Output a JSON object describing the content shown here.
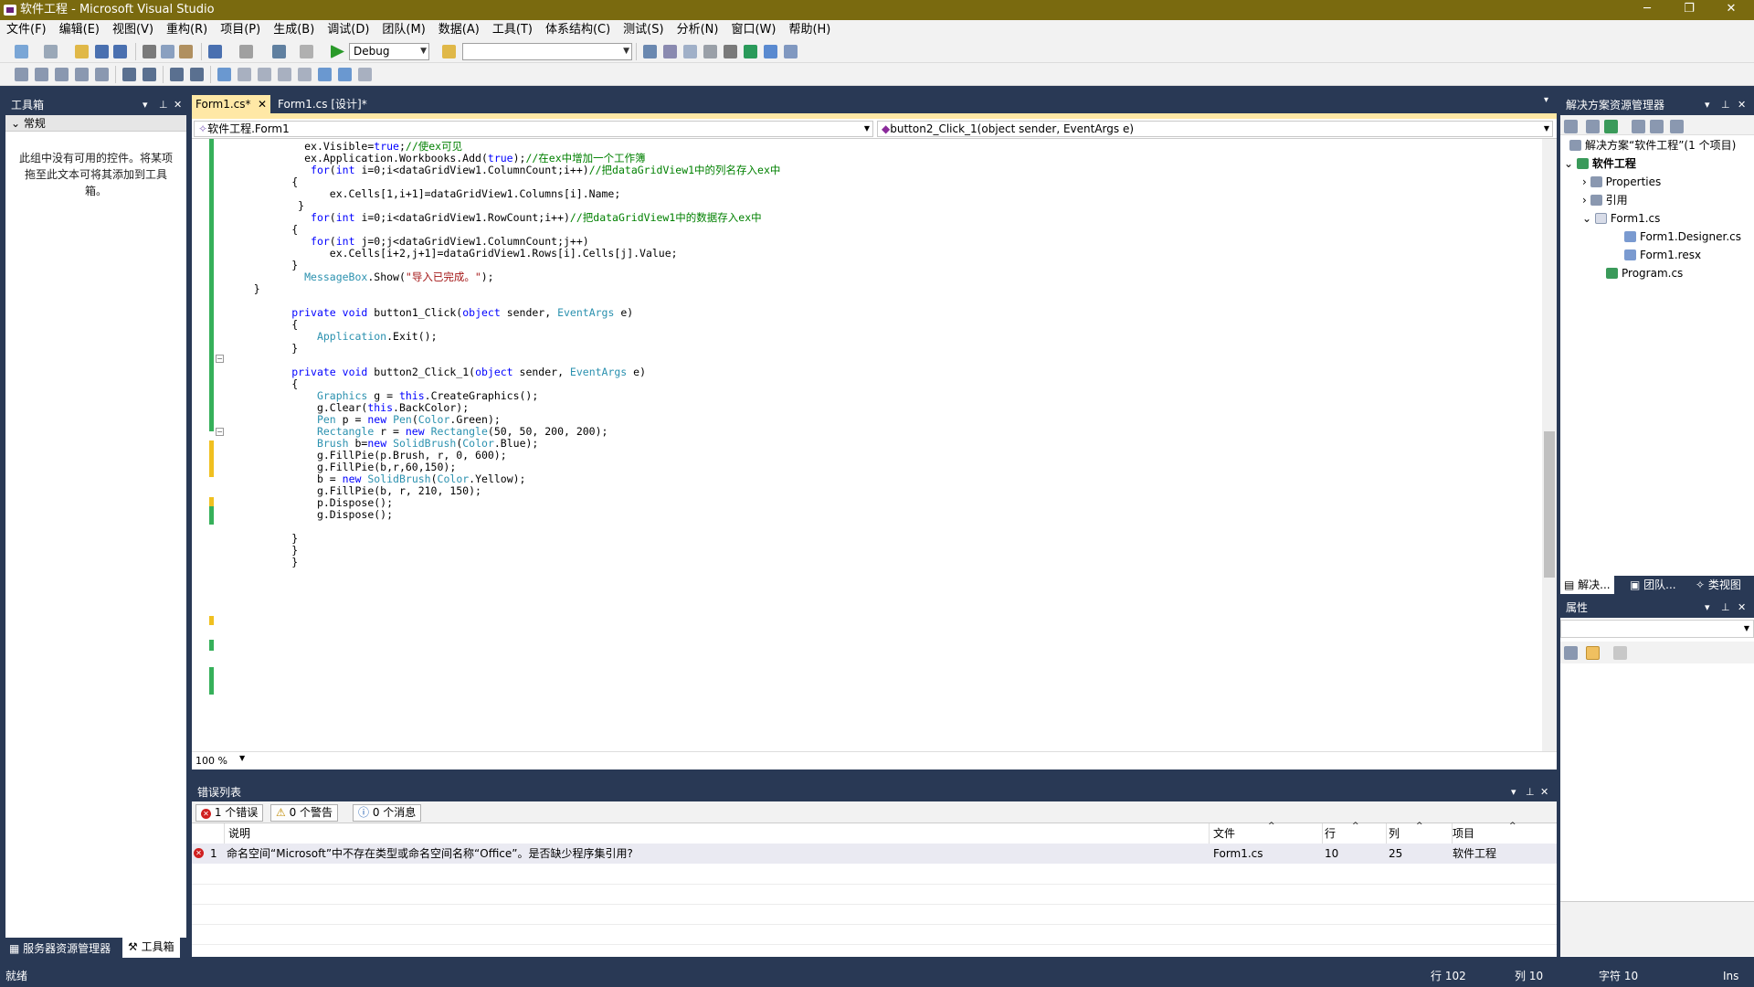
{
  "window": {
    "title": "软件工程 - Microsoft Visual Studio",
    "min": "─",
    "restore": "❐",
    "close": "✕"
  },
  "menu": [
    "文件(F)",
    "编辑(E)",
    "视图(V)",
    "重构(R)",
    "项目(P)",
    "生成(B)",
    "调试(D)",
    "团队(M)",
    "数据(A)",
    "工具(T)",
    "体系结构(C)",
    "测试(S)",
    "分析(N)",
    "窗口(W)",
    "帮助(H)"
  ],
  "toolbar": {
    "config": "Debug",
    "platform": ""
  },
  "toolbox": {
    "title": "工具箱",
    "section": "常规",
    "empty_text": "此组中没有可用的控件。将某项拖至此文本可将其添加到工具箱。",
    "tab_server": "服务器资源管理器",
    "tab_toolbox": "工具箱"
  },
  "doc_tabs": [
    {
      "label": "Form1.cs*",
      "active": true
    },
    {
      "label": "Form1.cs [设计]*",
      "active": false
    }
  ],
  "navbar": {
    "type": "软件工程.Form1",
    "member": "button2_Click_1(object sender, EventArgs e)"
  },
  "editor": {
    "zoom": "100 %"
  },
  "code": [
    [
      "            ",
      [
        "",
        "ex.Visible="
      ],
      [
        "kw",
        "true"
      ],
      [
        "",
        ";"
      ],
      [
        "cm",
        "//使ex可见"
      ]
    ],
    [
      "            ",
      [
        "",
        "ex.Application.Workbooks.Add("
      ],
      [
        "kw",
        "true"
      ],
      [
        "",
        ");"
      ],
      [
        "cm",
        "//在ex中增加一个工作簿"
      ]
    ],
    [
      "             ",
      [
        "kw",
        "for"
      ],
      [
        "",
        "("
      ],
      [
        "kw",
        "int"
      ],
      [
        "",
        " i=0;i<dataGridView1.ColumnCount;i++)"
      ],
      [
        "cm",
        "//把dataGridView1中的列名存入ex中"
      ]
    ],
    [
      "          ",
      [
        "",
        "{"
      ]
    ],
    [
      "                ",
      [
        "",
        "ex.Cells[1,i+1]=dataGridView1.Columns[i].Name;"
      ]
    ],
    [
      "           ",
      [
        "",
        "}"
      ]
    ],
    [
      "             ",
      [
        "kw",
        "for"
      ],
      [
        "",
        "("
      ],
      [
        "kw",
        "int"
      ],
      [
        "",
        " i=0;i<dataGridView1.RowCount;i++)"
      ],
      [
        "cm",
        "//把dataGridView1中的数据存入ex中"
      ]
    ],
    [
      "          ",
      [
        "",
        "{"
      ]
    ],
    [
      "             ",
      [
        "kw",
        "for"
      ],
      [
        "",
        "("
      ],
      [
        "kw",
        "int"
      ],
      [
        "",
        " j=0;j<dataGridView1.ColumnCount;j++)"
      ]
    ],
    [
      "                ",
      [
        "",
        "ex.Cells[i+2,j+1]=dataGridView1.Rows[i].Cells[j].Value;"
      ]
    ],
    [
      "          ",
      [
        "",
        "}"
      ]
    ],
    [
      "            ",
      [
        "ty",
        "MessageBox"
      ],
      [
        "",
        ".Show("
      ],
      [
        "st",
        "\"导入已完成。\""
      ],
      [
        "",
        ");"
      ]
    ],
    [
      "    ",
      [
        "",
        "}"
      ]
    ],
    [
      "",
      [
        "",
        ""
      ]
    ],
    [
      "          ",
      [
        "kw",
        "private"
      ],
      [
        "",
        " "
      ],
      [
        "kw",
        "void"
      ],
      [
        "",
        " button1_Click("
      ],
      [
        "kw",
        "object"
      ],
      [
        "",
        " sender, "
      ],
      [
        "ty",
        "EventArgs"
      ],
      [
        "",
        " e)"
      ]
    ],
    [
      "          ",
      [
        "",
        "{"
      ]
    ],
    [
      "              ",
      [
        "ty",
        "Application"
      ],
      [
        "",
        ".Exit();"
      ]
    ],
    [
      "          ",
      [
        "",
        "}"
      ]
    ],
    [
      "",
      [
        "",
        ""
      ]
    ],
    [
      "          ",
      [
        "kw",
        "private"
      ],
      [
        "",
        " "
      ],
      [
        "kw",
        "void"
      ],
      [
        "",
        " button2_Click_1("
      ],
      [
        "kw",
        "object"
      ],
      [
        "",
        " sender, "
      ],
      [
        "ty",
        "EventArgs"
      ],
      [
        "",
        " e)"
      ]
    ],
    [
      "          ",
      [
        "",
        "{"
      ]
    ],
    [
      "              ",
      [
        "ty",
        "Graphics"
      ],
      [
        "",
        " g = "
      ],
      [
        "kw",
        "this"
      ],
      [
        "",
        ".CreateGraphics();"
      ]
    ],
    [
      "              ",
      [
        "",
        "g.Clear("
      ],
      [
        "kw",
        "this"
      ],
      [
        "",
        ".BackColor);"
      ]
    ],
    [
      "              ",
      [
        "ty",
        "Pen"
      ],
      [
        "",
        " p = "
      ],
      [
        "kw",
        "new"
      ],
      [
        "",
        " "
      ],
      [
        "ty",
        "Pen"
      ],
      [
        "",
        "("
      ],
      [
        "ty",
        "Color"
      ],
      [
        "",
        ".Green);"
      ]
    ],
    [
      "              ",
      [
        "ty",
        "Rectangle"
      ],
      [
        "",
        " r = "
      ],
      [
        "kw",
        "new"
      ],
      [
        "",
        " "
      ],
      [
        "ty",
        "Rectangle"
      ],
      [
        "",
        "(50, 50, 200, 200);"
      ]
    ],
    [
      "              ",
      [
        "ty",
        "Brush"
      ],
      [
        "",
        " b="
      ],
      [
        "kw",
        "new"
      ],
      [
        "",
        " "
      ],
      [
        "ty",
        "SolidBrush"
      ],
      [
        "",
        "("
      ],
      [
        "ty",
        "Color"
      ],
      [
        "",
        ".Blue);"
      ]
    ],
    [
      "              ",
      [
        "",
        "g.FillPie(p.Brush, r, 0, 600);"
      ]
    ],
    [
      "              ",
      [
        "",
        "g.FillPie(b,r,60,150);"
      ]
    ],
    [
      "              ",
      [
        "",
        "b = "
      ],
      [
        "kw",
        "new"
      ],
      [
        "",
        " "
      ],
      [
        "ty",
        "SolidBrush"
      ],
      [
        "",
        "("
      ],
      [
        "ty",
        "Color"
      ],
      [
        "",
        ".Yellow);"
      ]
    ],
    [
      "              ",
      [
        "",
        "g.FillPie(b, r, 210, 150);"
      ]
    ],
    [
      "              ",
      [
        "",
        "p.Dispose();"
      ]
    ],
    [
      "              ",
      [
        "",
        "g.Dispose();"
      ]
    ],
    [
      "",
      [
        "",
        ""
      ]
    ],
    [
      "          ",
      [
        "",
        "}"
      ]
    ],
    [
      "          ",
      [
        "",
        "}"
      ]
    ],
    [
      "          ",
      [
        "",
        "}"
      ]
    ]
  ],
  "error_list": {
    "title": "错误列表",
    "errors_btn": "1 个错误",
    "warnings_btn": "0 个警告",
    "messages_btn": "0 个消息",
    "columns": [
      "说明",
      "文件",
      "行",
      "列",
      "项目"
    ],
    "rows": [
      {
        "num": "1",
        "desc": "命名空间“Microsoft”中不存在类型或命名空间名称“Office”。是否缺少程序集引用?",
        "file": "Form1.cs",
        "line": "10",
        "col": "25",
        "project": "软件工程"
      }
    ]
  },
  "solution": {
    "title": "解决方案资源管理器",
    "root": "解决方案“软件工程”(1 个项目)",
    "project": "软件工程",
    "items": [
      "Properties",
      "引用",
      "Form1.cs",
      "Form1.Designer.cs",
      "Form1.resx",
      "Program.cs"
    ],
    "tabs": [
      "解决...",
      "团队...",
      "类视图"
    ]
  },
  "properties": {
    "title": "属性"
  },
  "status": {
    "ready": "就绪",
    "line": "行 102",
    "col": "列 10",
    "ch": "字符 10",
    "mode": "Ins"
  },
  "colors": {
    "chrome": "#293955",
    "title": "#7a6a0f",
    "green_change": "#36b05a",
    "yellow_change": "#f0c020"
  }
}
